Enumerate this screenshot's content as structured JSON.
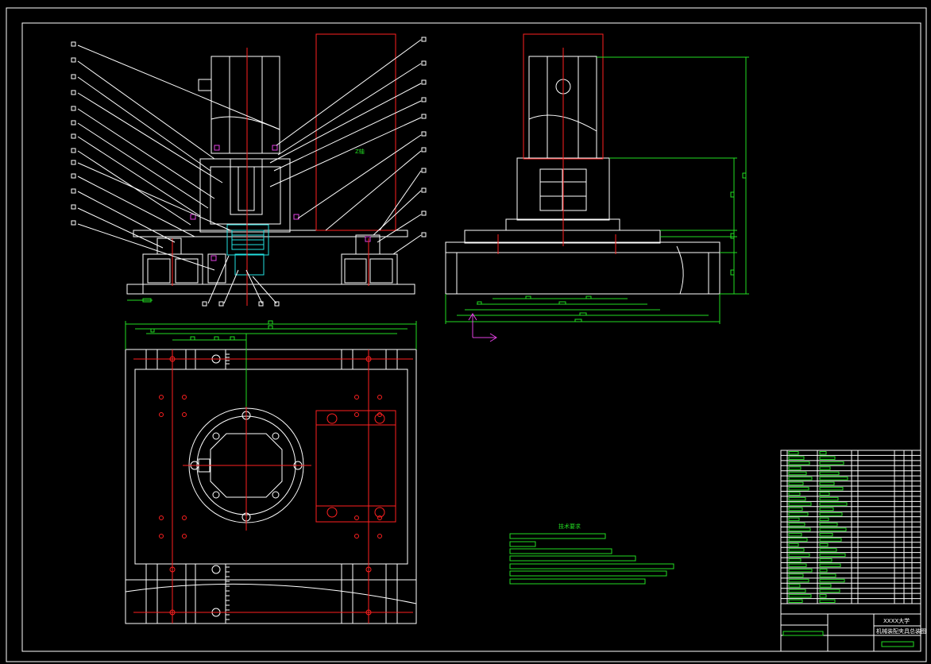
{
  "drawing": {
    "section_label": "Z轴",
    "tech_req_title": "技术要求",
    "title_block": {
      "company": "XXXX大学",
      "drawing_name": "机械装配夹具总装图"
    }
  }
}
